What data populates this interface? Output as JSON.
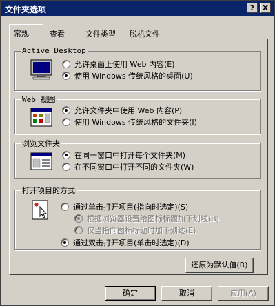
{
  "window": {
    "title": "文件夹选项",
    "help_button": "?",
    "close_button": "X"
  },
  "tabs": [
    {
      "label": "常规",
      "active": true
    },
    {
      "label": "查看"
    },
    {
      "label": "文件类型"
    },
    {
      "label": "脱机文件"
    }
  ],
  "groups": {
    "active_desktop": {
      "label": "Active Desktop",
      "options": [
        {
          "label": "允许桌面上使用 Web 内容(E)",
          "checked": false
        },
        {
          "label": "使用 Windows 传统风格的桌面(U)",
          "checked": true
        }
      ]
    },
    "web_view": {
      "label": "Web 视图",
      "options": [
        {
          "label": "允许文件夹中使用 Web 内容(P)",
          "checked": true
        },
        {
          "label": "使用 Windows 传统风格的文件夹(I)",
          "checked": false
        }
      ]
    },
    "browse_folders": {
      "label": "浏览文件夹",
      "options": [
        {
          "label": "在同一窗口中打开每个文件夹(M)",
          "checked": true
        },
        {
          "label": "在不同窗口中打开不同的文件夹(W)",
          "checked": false
        }
      ]
    },
    "open_items": {
      "label": "打开项目的方式",
      "options": [
        {
          "label": "通过单击打开项目(指向时选定)(S)",
          "checked": false
        },
        {
          "label": "根据浏览器设置给图标标题加下划线(B)",
          "checked": true,
          "disabled": true
        },
        {
          "label": "仅当指向图标标题时加下划线(E)",
          "checked": false,
          "disabled": true
        },
        {
          "label": "通过双击打开项目(单击时选定)(D)",
          "checked": true
        }
      ]
    }
  },
  "restore_defaults": "还原为默认值(R)",
  "footer": {
    "ok": "确定",
    "cancel": "取消",
    "apply": "应用(A)"
  },
  "icons": [
    "monitor-icon",
    "web-folder-icon",
    "browse-window-icon",
    "click-cursor-icon"
  ]
}
